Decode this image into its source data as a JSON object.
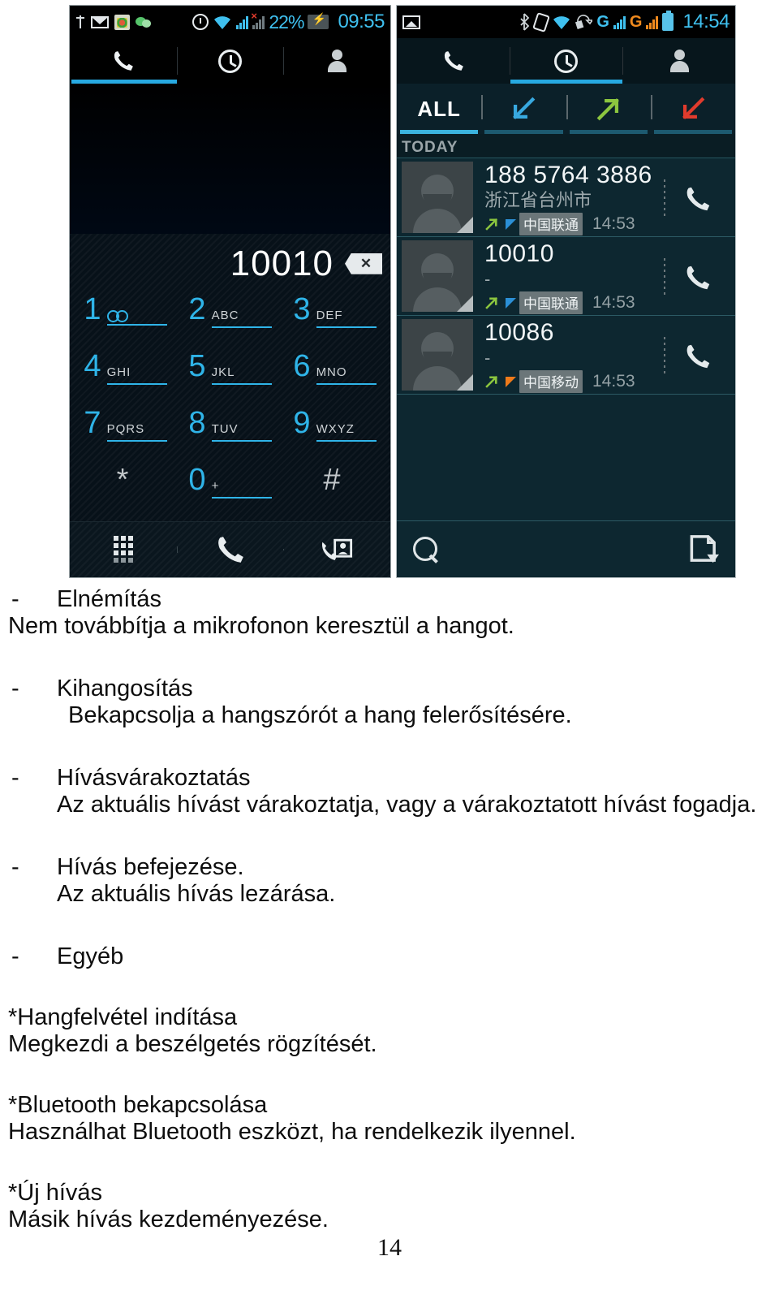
{
  "document": {
    "page_number": "14"
  },
  "left_phone": {
    "status_bar": {
      "icons": [
        "usb-icon",
        "mail-icon",
        "play-store-icon",
        "wechat-icon",
        "alarm-icon",
        "wifi-icon",
        "signal-sim1-icon",
        "signal-sim2-no-service-icon"
      ],
      "battery_percent": "22%",
      "battery_icon": "battery-charging-icon",
      "clock": "09:55"
    },
    "tabs": [
      {
        "name": "phone-tab",
        "icon": "phone-icon",
        "active": true
      },
      {
        "name": "recents-tab",
        "icon": "clock-icon",
        "active": false
      },
      {
        "name": "contacts-tab",
        "icon": "person-icon",
        "active": false
      }
    ],
    "dialer": {
      "entered_number": "10010",
      "backspace_icon": "backspace-icon",
      "keys": [
        {
          "digit": "1",
          "letters": "",
          "icon": "voicemail-icon"
        },
        {
          "digit": "2",
          "letters": "ABC",
          "icon": ""
        },
        {
          "digit": "3",
          "letters": "DEF",
          "icon": ""
        },
        {
          "digit": "4",
          "letters": "GHI",
          "icon": ""
        },
        {
          "digit": "5",
          "letters": "JKL",
          "icon": ""
        },
        {
          "digit": "6",
          "letters": "MNO",
          "icon": ""
        },
        {
          "digit": "7",
          "letters": "PQRS",
          "icon": ""
        },
        {
          "digit": "8",
          "letters": "TUV",
          "icon": ""
        },
        {
          "digit": "9",
          "letters": "WXYZ",
          "icon": ""
        },
        {
          "digit": "*",
          "letters": "",
          "icon": ""
        },
        {
          "digit": "0",
          "letters": "+",
          "icon": ""
        },
        {
          "digit": "#",
          "letters": "",
          "icon": ""
        }
      ],
      "bottom_bar": [
        "keypad-grid-icon",
        "call-icon",
        "add-contact-call-icon"
      ]
    }
  },
  "right_phone": {
    "status_bar": {
      "icons": [
        "screenshot-icon",
        "bluetooth-icon",
        "vibrate-icon",
        "wifi-icon",
        "sync-icon"
      ],
      "network_sim1": "G",
      "network_sim2": "G",
      "battery_icon": "battery-icon",
      "clock": "14:54"
    },
    "tabs": [
      {
        "name": "phone-tab",
        "icon": "phone-icon",
        "active": false
      },
      {
        "name": "recents-tab",
        "icon": "clock-icon",
        "active": true
      },
      {
        "name": "contacts-tab",
        "icon": "person-icon",
        "active": false
      }
    ],
    "call_log": {
      "filters": [
        {
          "label": "ALL",
          "icon": "",
          "active": true
        },
        {
          "label": "",
          "icon": "incoming-call-arrow-icon",
          "active": false
        },
        {
          "label": "",
          "icon": "outgoing-call-arrow-icon",
          "active": false
        },
        {
          "label": "",
          "icon": "missed-call-arrow-icon",
          "active": false
        }
      ],
      "section_header": "TODAY",
      "entries": [
        {
          "number": "188 5764 3886",
          "location": "浙江省台州市",
          "direction_icon": "outgoing-call-arrow-icon",
          "sim_color": "#2b8fd6",
          "carrier": "中国联通",
          "time": "14:53",
          "action_icon": "call-icon"
        },
        {
          "number": "10010",
          "location": "-",
          "direction_icon": "outgoing-call-arrow-icon",
          "sim_color": "#2b8fd6",
          "carrier": "中国联通",
          "time": "14:53",
          "action_icon": "call-icon"
        },
        {
          "number": "10086",
          "location": "-",
          "direction_icon": "outgoing-call-arrow-icon",
          "sim_color": "#ef7a1a",
          "carrier": "中国移动",
          "time": "14:53",
          "action_icon": "call-icon"
        }
      ],
      "bottom_bar": [
        "search-icon",
        "export-log-icon"
      ]
    }
  },
  "body_text": {
    "items": [
      {
        "dash": "-",
        "title": "Elnémítás",
        "desc": "Nem továbbítja a mikrofonon keresztül a hangot.",
        "desc_indent": "flush"
      },
      {
        "dash": "-",
        "title": "Kihangosítás",
        "desc": "Bekapcsolja a hangszórót a hang felerősítésére.",
        "desc_indent": "indent"
      },
      {
        "dash": "-",
        "title": "Hívásvárakoztatás",
        "desc": "Az aktuális hívást várakoztatja, vagy a várakoztatott hívást fogadja.",
        "desc_indent": "indent-sm"
      },
      {
        "dash": "-",
        "title": "Hívás befejezése.",
        "desc": "Az aktuális hívás lezárása.",
        "desc_indent": "indent-sm"
      },
      {
        "dash": "-",
        "title": "Egyéb",
        "desc": "",
        "desc_indent": "flush"
      }
    ],
    "sub_items": [
      {
        "title": "*Hangfelvétel indítása",
        "desc": "Megkezdi a beszélgetés rögzítését."
      },
      {
        "title": "*Bluetooth bekapcsolása",
        "desc": "Használhat Bluetooth eszközt, ha rendelkezik ilyennel."
      },
      {
        "title": "*Új hívás",
        "desc": "Másik hívás kezdeményezése."
      }
    ]
  },
  "colors": {
    "accent_blue": "#27a9e1",
    "key_cyan": "#2fb4e8",
    "incoming": "#38a9e0",
    "outgoing": "#8cc63f",
    "missed": "#e03b2d",
    "sim1": "#2b8fd6",
    "sim2": "#ef7a1a"
  }
}
